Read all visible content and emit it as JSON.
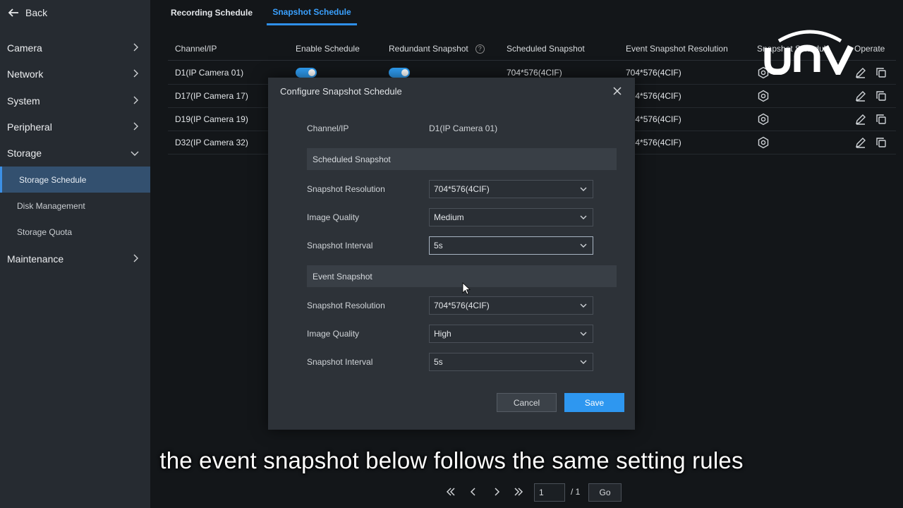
{
  "sidebar": {
    "back_label": "Back",
    "items": [
      {
        "label": "Camera"
      },
      {
        "label": "Network"
      },
      {
        "label": "System"
      },
      {
        "label": "Peripheral"
      },
      {
        "label": "Storage"
      },
      {
        "label": "Maintenance"
      }
    ],
    "sub_items": [
      {
        "label": "Storage Schedule",
        "active": true
      },
      {
        "label": "Disk Management"
      },
      {
        "label": "Storage Quota"
      }
    ]
  },
  "tabs": [
    {
      "label": "Recording Schedule"
    },
    {
      "label": "Snapshot Schedule",
      "active": true
    }
  ],
  "table": {
    "headers": [
      "Channel/IP",
      "Enable Schedule",
      "Redundant Snapshot",
      "Scheduled Snapshot",
      "Event Snapshot Resolution",
      "Snapshot Schedule",
      "Operate"
    ],
    "rows": [
      {
        "channel": "D1(IP Camera 01)",
        "scheduled": "704*576(4CIF)",
        "event": "704*576(4CIF)"
      },
      {
        "channel": "D17(IP Camera 17)",
        "event": "704*576(4CIF)"
      },
      {
        "channel": "D19(IP Camera 19)",
        "event": "704*576(4CIF)"
      },
      {
        "channel": "D32(IP Camera 32)",
        "event": "704*576(4CIF)"
      }
    ]
  },
  "logo_text": "UNV",
  "modal": {
    "title": "Configure Snapshot Schedule",
    "channel_label": "Channel/IP",
    "channel_value": "D1(IP Camera 01)",
    "scheduled_section": "Scheduled Snapshot",
    "event_section": "Event Snapshot",
    "scheduled": {
      "resolution_label": "Snapshot Resolution",
      "resolution_value": "704*576(4CIF)",
      "quality_label": "Image Quality",
      "quality_value": "Medium",
      "interval_label": "Snapshot Interval",
      "interval_value": "5s"
    },
    "event": {
      "resolution_label": "Snapshot Resolution",
      "resolution_value": "704*576(4CIF)",
      "quality_label": "Image Quality",
      "quality_value": "High",
      "interval_label": "Snapshot Interval",
      "interval_value": "5s"
    },
    "cancel_label": "Cancel",
    "save_label": "Save"
  },
  "caption": "the event snapshot below follows the same setting rules",
  "pagination": {
    "current_page": "1",
    "total": "/ 1",
    "go_label": "Go"
  },
  "colors": {
    "accent": "#2e97f0",
    "sidebar_bg": "#262b31",
    "active_item_bg": "#33506f"
  }
}
